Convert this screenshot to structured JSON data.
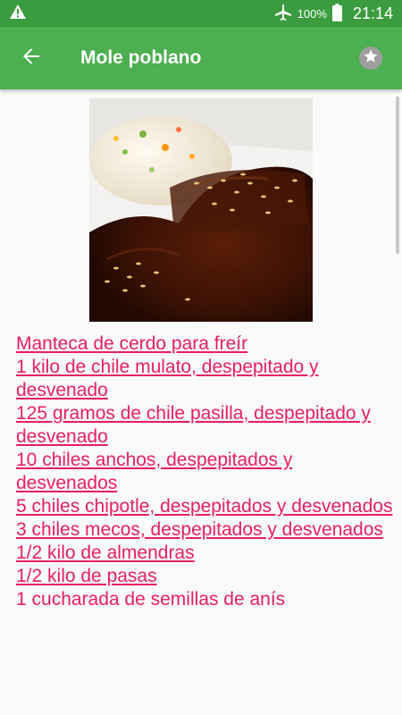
{
  "status_bar": {
    "battery_percent": "100%",
    "time": "21:14",
    "icons": [
      "warning-icon",
      "airplane-icon",
      "battery-icon"
    ]
  },
  "app_bar": {
    "title": "Mole poblano",
    "back_icon": "arrow-back-icon",
    "favorite_icon": "star-icon"
  },
  "recipe": {
    "image_description_icon": "dish-photo",
    "ingredients": [
      {
        "text": "Manteca de cerdo para freír",
        "linked": true
      },
      {
        "text": "1 kilo de chile mulato, despepitado y desvenado",
        "linked": true
      },
      {
        "text": "125 gramos de chile pasilla, despepitado y desvenado",
        "linked": true
      },
      {
        "text": "10 chiles anchos, despepitados y desvenados",
        "linked": true
      },
      {
        "text": "5 chiles chipotle, despepitados y desvenados",
        "linked": true
      },
      {
        "text": "3 chiles mecos, despepitados y desvenados",
        "linked": true
      },
      {
        "text": "1/2 kilo de almendras",
        "linked": true
      },
      {
        "text": "1/2 kilo de pasas",
        "linked": true
      },
      {
        "text": "1 cucharada de semillas de anís",
        "linked": false
      }
    ]
  },
  "colors": {
    "status_bar": "#3a9c3e",
    "app_bar": "#4caf50",
    "ingredient_text": "#e91e63",
    "background": "#fafafa"
  }
}
